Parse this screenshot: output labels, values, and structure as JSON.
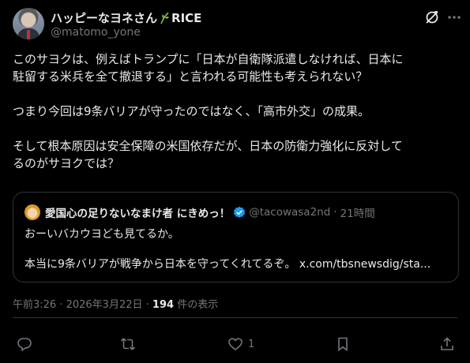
{
  "author": {
    "display_name": "ハッピーなヨネさん",
    "suffix": "RICE",
    "handle": "@matomo_yone"
  },
  "post": {
    "lines": [
      "このサヨクは、例えばトランプに「日本が自衛隊派遣しなければ、日本に",
      "駐留する米兵を全て撤退する」と言われる可能性も考えられない？",
      "つまり今回は9条バリアが守ったのではなく、「高市外交」の成果。",
      "そして根本原因は安全保障の米国依存だが、日本の防衛力強化に反対して",
      "るのがサヨクでは？"
    ]
  },
  "quote": {
    "display_name": "愛国心の足りないなまけ者 にきめっ！",
    "handle": "@tacowasa2nd",
    "separator": "·",
    "time": "21時間",
    "line1": "おーいバカウヨども見てるか。",
    "line2_text": "本当に9条バリアが戦争から日本を守ってくれてるぞ。",
    "line2_link": "x.com/tbsnewsdig/sta..."
  },
  "meta": {
    "timestamp": "午前3:26 · 2026年3月22日 ·",
    "views_count": "194",
    "views_label": "件の表示"
  },
  "actions": {
    "like_count": "1"
  },
  "icons": {
    "leaf": "rice-leaf-icon",
    "grok": "grok-icon",
    "more": "more-icon",
    "verified": "verified-badge-icon",
    "reply": "reply-icon",
    "retweet": "retweet-icon",
    "like": "heart-icon",
    "bookmark": "bookmark-icon",
    "share": "share-icon"
  },
  "colors": {
    "background": "#000000",
    "text": "#e7e9ea",
    "secondary": "#71767b",
    "border": "#2f3336",
    "verified": "#1d9bf0",
    "leaf": "#7cc142"
  }
}
